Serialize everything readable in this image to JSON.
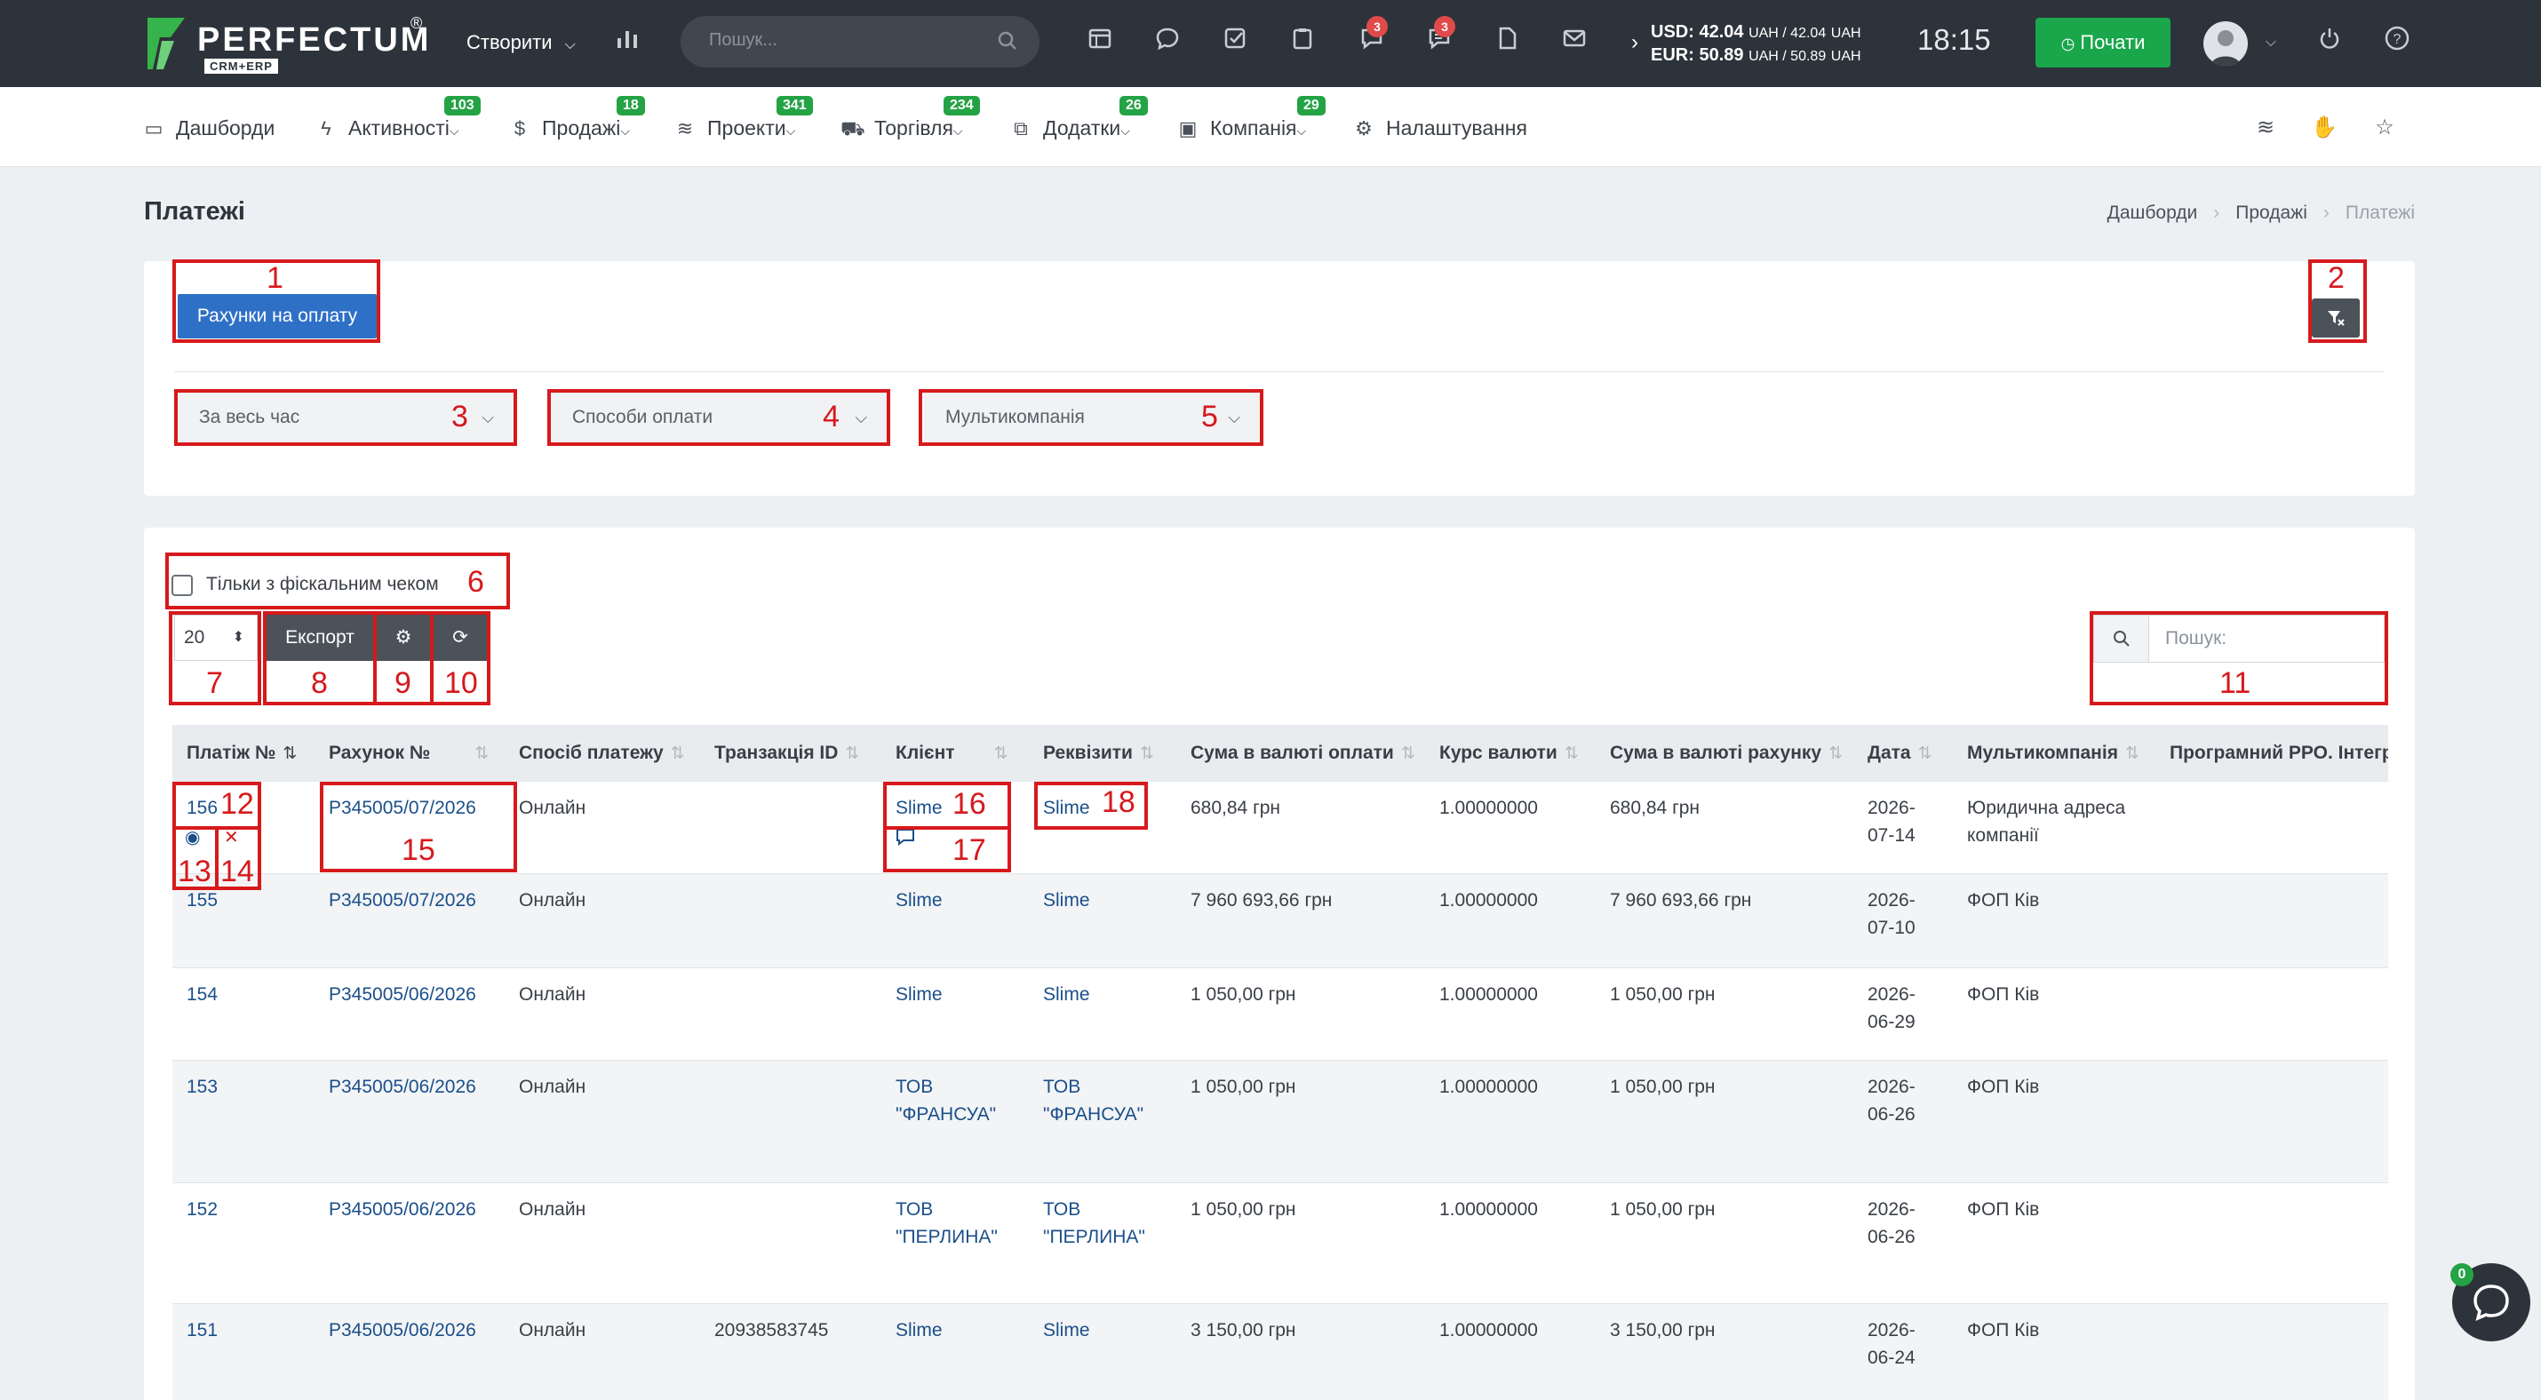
{
  "brand": {
    "name": "PERFECTUM",
    "reg": "®",
    "sub": "CRM+ERP"
  },
  "topbar": {
    "create_label": "Створити",
    "search_placeholder": "Пошук...",
    "notif_badge_1": "3",
    "notif_badge_2": "3",
    "rates": {
      "usd": "USD: 42.04",
      "usd_unit": "UAH / 42.04",
      "usd_unit2": "UAH",
      "eur": "EUR: 50.89",
      "eur_unit": "UAH / 50.89",
      "eur_unit2": "UAH"
    },
    "time": "18:15",
    "start_label": "Почати"
  },
  "nav": {
    "items": [
      {
        "label": "Дашборди",
        "badge": ""
      },
      {
        "label": "Активності",
        "badge": "103"
      },
      {
        "label": "Продажі",
        "badge": "18"
      },
      {
        "label": "Проекти",
        "badge": "341"
      },
      {
        "label": "Торгівля",
        "badge": "234"
      },
      {
        "label": "Додатки",
        "badge": "26"
      },
      {
        "label": "Компанія",
        "badge": "29"
      },
      {
        "label": "Налаштування",
        "badge": ""
      }
    ]
  },
  "page": {
    "title": "Платежі",
    "breadcrumb": [
      "Дашборди",
      "Продажі",
      "Платежі"
    ]
  },
  "filters": {
    "invoice_button": "Рахунки на оплату",
    "period": "За весь час",
    "payment_methods": "Способи оплати",
    "multicompany": "Мультикомпанія"
  },
  "table_tools": {
    "fiscal_only": "Тільки з фіскальним чеком",
    "per_page": "20",
    "export": "Експорт",
    "search_placeholder": "Пошук:"
  },
  "annotations": [
    "1",
    "2",
    "3",
    "4",
    "5",
    "6",
    "7",
    "8",
    "9",
    "10",
    "11",
    "12",
    "13",
    "14",
    "15",
    "16",
    "17",
    "18"
  ],
  "table": {
    "columns": [
      "Платіж №",
      "Рахунок №",
      "Спосіб платежу",
      "Транзакція ID",
      "Клієнт",
      "Реквізити",
      "Сума в валюті оплати",
      "Курс валюти",
      "Сума в валюті рахунку",
      "Дата",
      "Мультикомпанія",
      "Програмний РРО. Інтегр"
    ],
    "rows": [
      {
        "id": "156",
        "invoice": "P345005/07/2026",
        "method": "Онлайн",
        "txn": "",
        "client": "Slime",
        "client2": "",
        "req": "Slime",
        "req2": "",
        "sum_pay": "680,84 грн",
        "rate": "1.00000000",
        "sum_inv": "680,84 грн",
        "date1": "2026-",
        "date2": "07-14",
        "company": "Юридична адреса",
        "company2": "компанії"
      },
      {
        "id": "155",
        "invoice": "P345005/07/2026",
        "method": "Онлайн",
        "txn": "",
        "client": "Slime",
        "client2": "",
        "req": "Slime",
        "req2": "",
        "sum_pay": "7 960 693,66 грн",
        "rate": "1.00000000",
        "sum_inv": "7 960 693,66 грн",
        "date1": "2026-",
        "date2": "07-10",
        "company": "ФОП Ків",
        "company2": ""
      },
      {
        "id": "154",
        "invoice": "P345005/06/2026",
        "method": "Онлайн",
        "txn": "",
        "client": "Slime",
        "client2": "",
        "req": "Slime",
        "req2": "",
        "sum_pay": "1 050,00 грн",
        "rate": "1.00000000",
        "sum_inv": "1 050,00 грн",
        "date1": "2026-",
        "date2": "06-29",
        "company": "ФОП Ків",
        "company2": ""
      },
      {
        "id": "153",
        "invoice": "P345005/06/2026",
        "method": "Онлайн",
        "txn": "",
        "client": "ТОВ",
        "client2": "\"ФРАНСУА\"",
        "req": "ТОВ",
        "req2": "\"ФРАНСУА\"",
        "sum_pay": "1 050,00 грн",
        "rate": "1.00000000",
        "sum_inv": "1 050,00 грн",
        "date1": "2026-",
        "date2": "06-26",
        "company": "ФОП Ків",
        "company2": ""
      },
      {
        "id": "152",
        "invoice": "P345005/06/2026",
        "method": "Онлайн",
        "txn": "",
        "client": "ТОВ",
        "client2": "\"ПЕРЛИНА\"",
        "req": "ТОВ",
        "req2": "\"ПЕРЛИНА\"",
        "sum_pay": "1 050,00 грн",
        "rate": "1.00000000",
        "sum_inv": "1 050,00 грн",
        "date1": "2026-",
        "date2": "06-26",
        "company": "ФОП Ків",
        "company2": ""
      },
      {
        "id": "151",
        "invoice": "P345005/06/2026",
        "method": "Онлайн",
        "txn": "20938583745",
        "client": "Slime",
        "client2": "",
        "req": "Slime",
        "req2": "",
        "sum_pay": "3 150,00 грн",
        "rate": "1.00000000",
        "sum_inv": "3 150,00 грн",
        "date1": "2026-",
        "date2": "06-24",
        "company": "ФОП Ків",
        "company2": ""
      }
    ]
  },
  "chat": {
    "badge": "0"
  },
  "colors": {
    "topbar": "#2d333a",
    "accent_blue": "#2f70c7",
    "start_green": "#1aa64a",
    "badge_green": "#24a344",
    "badge_red": "#e04a4a",
    "annotation_red": "#d7191c",
    "link": "#1b4f8a"
  }
}
